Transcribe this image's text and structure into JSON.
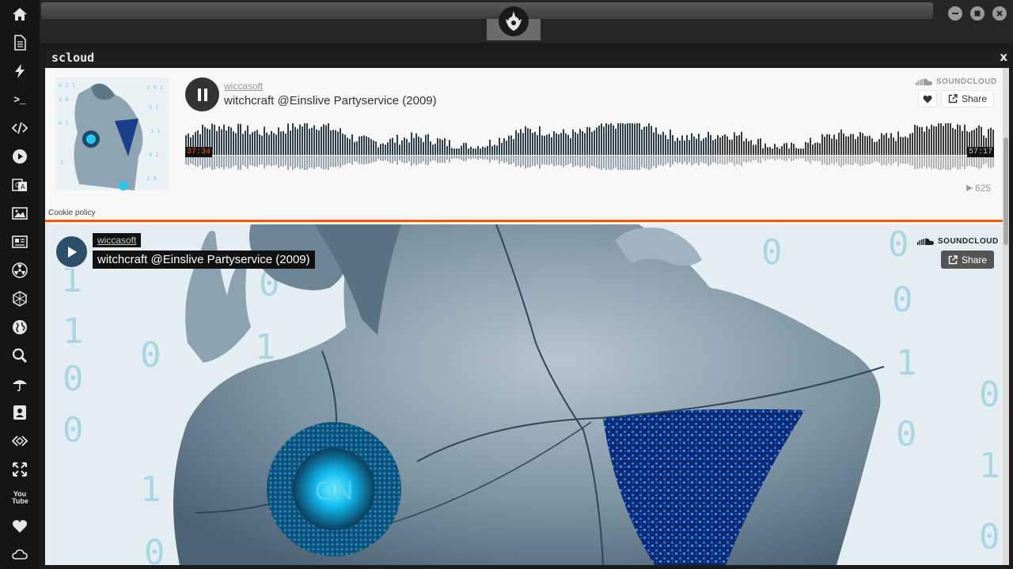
{
  "sidebar": {
    "items": [
      "home-icon",
      "document-icon",
      "lightning-icon",
      "terminal-icon",
      "code-icon",
      "play-icon",
      "translate-icon",
      "image-icon",
      "news-icon",
      "radiation-icon",
      "hexagon-icon",
      "globe-icon",
      "search-icon",
      "umbrella-icon",
      "contact-card-icon",
      "code-diamond-icon",
      "fullscreen-icon",
      "youtube-icon",
      "heart-icon",
      "cloud-icon"
    ],
    "terminal_label": ">_",
    "youtube_label": "You Tube"
  },
  "window": {
    "title": "scloud",
    "close_label": "x"
  },
  "player1": {
    "username": "wiccasoft",
    "track_title": "witchcraft @Einslive Partyservice (2009)",
    "brand": "SOUNDCLOUD",
    "share_label": "Share",
    "time_elapsed": "37:34",
    "time_total": "57:17",
    "progress": 0.656,
    "play_count": "625",
    "cookie_policy": "Cookie policy"
  },
  "player2": {
    "username": "wiccasoft",
    "track_title": "witchcraft @Einslive Partyservice (2009)",
    "brand": "SOUNDCLOUD",
    "share_label": "Share",
    "artwork_text": "ON"
  },
  "colors": {
    "accent": "#ff5500",
    "sidebar_bg": "#151515",
    "played_wave": "#323232",
    "unplayed_wave": "#9a9a9a"
  }
}
